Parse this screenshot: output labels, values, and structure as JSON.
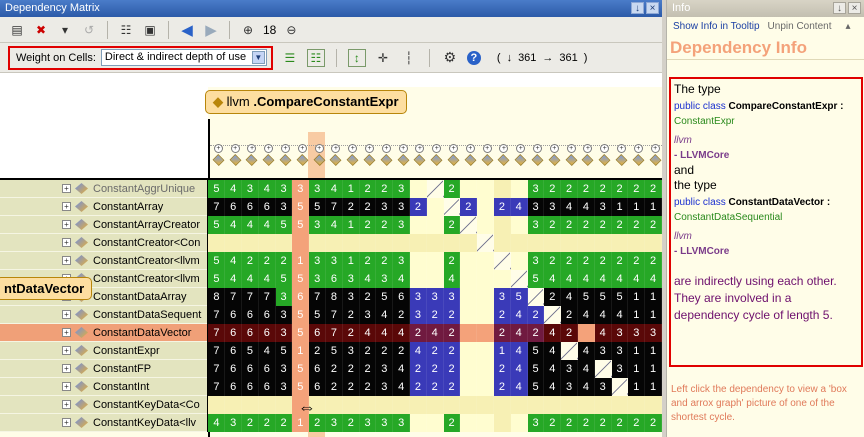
{
  "window": {
    "title": "Dependency Matrix",
    "btn_pin": " ",
    "btn_close": "×"
  },
  "toolbar": {
    "zoom_value": "18",
    "icons": [
      "window-icon",
      "delete-icon",
      "dropdown-icon",
      "undo-icon",
      "export-icon",
      "camera-icon",
      "back-icon",
      "forward-icon",
      "zoom-in-icon",
      "zoom-out-icon"
    ]
  },
  "weight": {
    "label": "Weight on Cells:",
    "selected": "Direct & indirect depth of use"
  },
  "counts": {
    "down": "361",
    "right": "361"
  },
  "column_callout": {
    "ns": "llvm ",
    "name": ".CompareConstantExpr"
  },
  "row_callout": {
    "text": "ntDataVector"
  },
  "rows": [
    {
      "name": "ConstantAggrUnique",
      "gray": true,
      "cells": [
        "g5",
        "g4",
        "g3",
        "g4",
        "g3",
        "o3",
        "g3",
        "g4",
        "g1",
        "g2",
        "g2",
        "g3",
        "y",
        "d",
        "g2",
        "y",
        "y",
        "p",
        "y",
        "g3",
        "g2",
        "g2",
        "g2",
        "g2",
        "g2",
        "g2",
        "g2"
      ]
    },
    {
      "name": "ConstantArray",
      "gray": false,
      "cells": [
        "k7",
        "k6",
        "k6",
        "k6",
        "k3",
        "o5",
        "k5",
        "k7",
        "k2",
        "k2",
        "k3",
        "k3",
        "b2",
        "y",
        "d",
        "b2",
        "y",
        "b2",
        "b4",
        "k3",
        "k3",
        "k4",
        "k4",
        "k3",
        "k1",
        "k1",
        "k1"
      ]
    },
    {
      "name": "ConstantArrayCreator",
      "gray": false,
      "cells": [
        "g5",
        "g4",
        "g4",
        "g4",
        "g5",
        "o5",
        "g3",
        "g4",
        "g1",
        "g2",
        "g2",
        "g3",
        "y",
        "y",
        "g2",
        "d",
        "y",
        "p",
        "y",
        "g3",
        "g2",
        "g2",
        "g2",
        "g2",
        "g2",
        "g2",
        "g2"
      ]
    },
    {
      "name": "ConstantCreator<Con",
      "gray": false,
      "cells": [
        "p",
        "p",
        "p",
        "p",
        "p",
        "o",
        "p",
        "p",
        "p",
        "p",
        "p",
        "p",
        "p",
        "p",
        "p",
        "p",
        "d",
        "p",
        "p",
        "p",
        "p",
        "p",
        "p",
        "p",
        "p",
        "p",
        "p"
      ]
    },
    {
      "name": "ConstantCreator<llvm",
      "gray": false,
      "cells": [
        "g5",
        "g4",
        "g2",
        "g2",
        "g2",
        "o1",
        "g3",
        "g3",
        "g1",
        "g2",
        "g2",
        "g3",
        "y",
        "y",
        "g2",
        "y",
        "y",
        "d",
        "y",
        "g3",
        "g2",
        "g2",
        "g2",
        "g2",
        "g2",
        "g2",
        "g2"
      ]
    },
    {
      "name": "ConstantCreator<llvm",
      "gray": false,
      "cells": [
        "g5",
        "g4",
        "g4",
        "g4",
        "g5",
        "o5",
        "g3",
        "g6",
        "g3",
        "g4",
        "g3",
        "g4",
        "y",
        "y",
        "g4",
        "y",
        "y",
        "y",
        "d",
        "g5",
        "g4",
        "g4",
        "g4",
        "g4",
        "g4",
        "g4",
        "g4"
      ]
    },
    {
      "name": "ConstantDataArray",
      "gray": false,
      "cells": [
        "k8",
        "k7",
        "k7",
        "k7",
        "g3",
        "o6",
        "k7",
        "k8",
        "k3",
        "k2",
        "k5",
        "k6",
        "b3",
        "b3",
        "b3",
        "y",
        "y",
        "b3",
        "b5",
        "d",
        "k2",
        "k4",
        "k5",
        "k5",
        "k5",
        "k1",
        "k1"
      ]
    },
    {
      "name": "ConstantDataSequent",
      "gray": false,
      "cells": [
        "k7",
        "k6",
        "k6",
        "k6",
        "k3",
        "o5",
        "k5",
        "k7",
        "k2",
        "k3",
        "k4",
        "k2",
        "b3",
        "b2",
        "b2",
        "y",
        "y",
        "b2",
        "b4",
        "b2",
        "d",
        "k2",
        "k4",
        "k4",
        "k4",
        "k1",
        "k1"
      ]
    },
    {
      "name": "ConstantDataVector",
      "gray": false,
      "sel": true,
      "cells": [
        "k7",
        "k6",
        "k6",
        "k6",
        "k3",
        "o5",
        "k6",
        "k7",
        "k2",
        "k4",
        "k4",
        "k4",
        "b2",
        "b4",
        "b2",
        "o",
        "o",
        "b2",
        "b4",
        "b2",
        "k4",
        "k2",
        "o",
        "k4",
        "k3",
        "k3",
        "k3"
      ]
    },
    {
      "name": "ConstantExpr",
      "gray": false,
      "cells": [
        "k7",
        "k6",
        "k5",
        "k4",
        "k5",
        "o1",
        "k2",
        "k5",
        "k3",
        "k2",
        "k2",
        "k2",
        "b4",
        "b2",
        "b2",
        "y",
        "y",
        "b1",
        "b4",
        "k5",
        "k4",
        "d",
        "k4",
        "k3",
        "k3",
        "k1",
        "k1"
      ]
    },
    {
      "name": "ConstantFP",
      "gray": false,
      "cells": [
        "k7",
        "k6",
        "k6",
        "k6",
        "k3",
        "o5",
        "k6",
        "k2",
        "k2",
        "k2",
        "k3",
        "k4",
        "b2",
        "b2",
        "b2",
        "y",
        "y",
        "b2",
        "b4",
        "k5",
        "k4",
        "k3",
        "k4",
        "d",
        "k3",
        "k1",
        "k1"
      ]
    },
    {
      "name": "ConstantInt",
      "gray": false,
      "cells": [
        "k7",
        "k6",
        "k6",
        "k6",
        "k3",
        "o5",
        "k6",
        "k2",
        "k2",
        "k2",
        "k3",
        "k4",
        "b2",
        "b2",
        "b2",
        "y",
        "y",
        "b2",
        "b4",
        "k5",
        "k4",
        "k3",
        "k4",
        "k3",
        "d",
        "k1",
        "k1"
      ]
    },
    {
      "name": "ConstantKeyData<Co",
      "gray": false,
      "cells": [
        "p",
        "p",
        "p",
        "p",
        "p",
        "o",
        "p",
        "p",
        "p",
        "p",
        "p",
        "p",
        "p",
        "p",
        "p",
        "p",
        "p",
        "p",
        "p",
        "p",
        "p",
        "p",
        "p",
        "p",
        "p",
        "p",
        "p"
      ]
    },
    {
      "name": "ConstantKeyData<llv",
      "gray": false,
      "cells": [
        "g4",
        "g3",
        "g2",
        "g2",
        "g2",
        "o1",
        "g2",
        "g3",
        "g2",
        "g3",
        "g3",
        "g3",
        "y",
        "y",
        "g2",
        "y",
        "y",
        "p",
        "y",
        "g3",
        "g2",
        "g2",
        "g2",
        "g2",
        "g2",
        "g2",
        "g2"
      ]
    }
  ],
  "info": {
    "title": "Info",
    "link_tooltip": "Show Info in Tooltip",
    "link_unpin": "Unpin Content",
    "heading": "Dependency Info",
    "the_type": "The type",
    "line1_kw": "public class ",
    "line1_name": "CompareConstantExpr",
    "line1_colon": " :",
    "line1_base": "ConstantExpr",
    "ns1": "llvm",
    "pkg1": "- LLVMCore",
    "and": " and",
    "the_type2": "the type",
    "line2_kw": "public class ",
    "line2_name": "ConstantDataVector",
    "line2_colon": " :",
    "line2_base": "ConstantDataSequential",
    "ns2": "llvm",
    "pkg2": "- LLVMCore",
    "summary": "are indirectly using each other. They are involved in a dependency cycle of length 5.",
    "footer": "Left click the dependency to view a 'box and arrox graph' picture of one of the shortest cycle."
  }
}
